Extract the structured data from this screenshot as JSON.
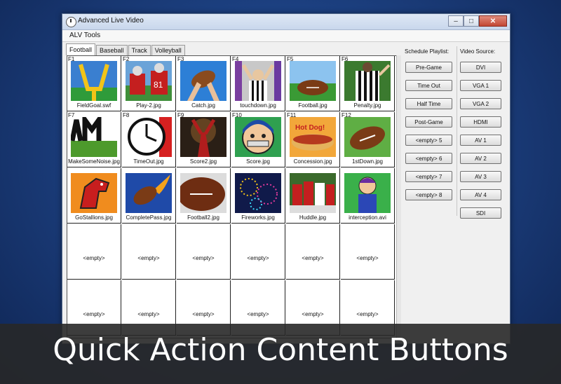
{
  "window": {
    "title": "Advanced Live Video"
  },
  "menu": {
    "tools": "ALV Tools"
  },
  "tabs": [
    {
      "label": "Football",
      "active": true
    },
    {
      "label": "Baseball",
      "active": false
    },
    {
      "label": "Track",
      "active": false
    },
    {
      "label": "Volleyball",
      "active": false
    }
  ],
  "grid": {
    "cells": [
      {
        "key": "F1",
        "file": "FieldGoal.swf",
        "icon": "goal-post"
      },
      {
        "key": "F2",
        "file": "Play-2.jpg",
        "icon": "players"
      },
      {
        "key": "F3",
        "file": "Catch.jpg",
        "icon": "catch"
      },
      {
        "key": "F4",
        "file": "touchdown.jpg",
        "icon": "referee"
      },
      {
        "key": "F5",
        "file": "Football.jpg",
        "icon": "football-field"
      },
      {
        "key": "F6",
        "file": "Penalty.jpg",
        "icon": "referee-stripes"
      },
      {
        "key": "F7",
        "file": "MakeSomeNoise.jpg",
        "icon": "noise"
      },
      {
        "key": "F8",
        "file": "TimeOut.jpg",
        "icon": "clock"
      },
      {
        "key": "F9",
        "file": "Score2.jpg",
        "icon": "score"
      },
      {
        "key": "F10",
        "file": "Score.jpg",
        "icon": "helmet"
      },
      {
        "key": "F11",
        "file": "Concession.jpg",
        "icon": "hotdog"
      },
      {
        "key": "F12",
        "file": "1stDown.jpg",
        "icon": "football"
      },
      {
        "key": "",
        "file": "GoStallions.jpg",
        "icon": "stallion"
      },
      {
        "key": "",
        "file": "CompletePass.jpg",
        "icon": "fire-ball"
      },
      {
        "key": "",
        "file": "Football2.jpg",
        "icon": "football-closeup"
      },
      {
        "key": "",
        "file": "Fireworks.jpg",
        "icon": "fireworks"
      },
      {
        "key": "",
        "file": "Huddle.jpg",
        "icon": "huddle"
      },
      {
        "key": "",
        "file": "interception.avi",
        "icon": "cartoon-player"
      },
      {
        "key": "",
        "file": "<empty>",
        "icon": ""
      },
      {
        "key": "",
        "file": "<empty>",
        "icon": ""
      },
      {
        "key": "",
        "file": "<empty>",
        "icon": ""
      },
      {
        "key": "",
        "file": "<empty>",
        "icon": ""
      },
      {
        "key": "",
        "file": "<empty>",
        "icon": ""
      },
      {
        "key": "",
        "file": "<empty>",
        "icon": ""
      },
      {
        "key": "",
        "file": "<empty>",
        "icon": ""
      },
      {
        "key": "",
        "file": "<empty>",
        "icon": ""
      },
      {
        "key": "",
        "file": "<empty>",
        "icon": ""
      },
      {
        "key": "",
        "file": "<empty>",
        "icon": ""
      },
      {
        "key": "",
        "file": "<empty>",
        "icon": ""
      },
      {
        "key": "",
        "file": "<empty>",
        "icon": ""
      }
    ]
  },
  "schedule": {
    "label": "Schedule Playlist:",
    "buttons": [
      "Pre-Game",
      "Time Out",
      "Half Time",
      "Post-Game",
      "<empty> 5",
      "<empty> 6",
      "<empty> 7",
      "<empty> 8"
    ]
  },
  "video_source": {
    "label": "Video Source:",
    "buttons": [
      "DVI",
      "VGA 1",
      "VGA 2",
      "HDMI",
      "AV 1",
      "AV 2",
      "AV 3",
      "AV 4",
      "SDI"
    ]
  },
  "caption": "Quick Action Content Buttons",
  "colors": {
    "background": "#1a3b78",
    "caption_bar": "#282828",
    "close_button": "#c24734"
  }
}
